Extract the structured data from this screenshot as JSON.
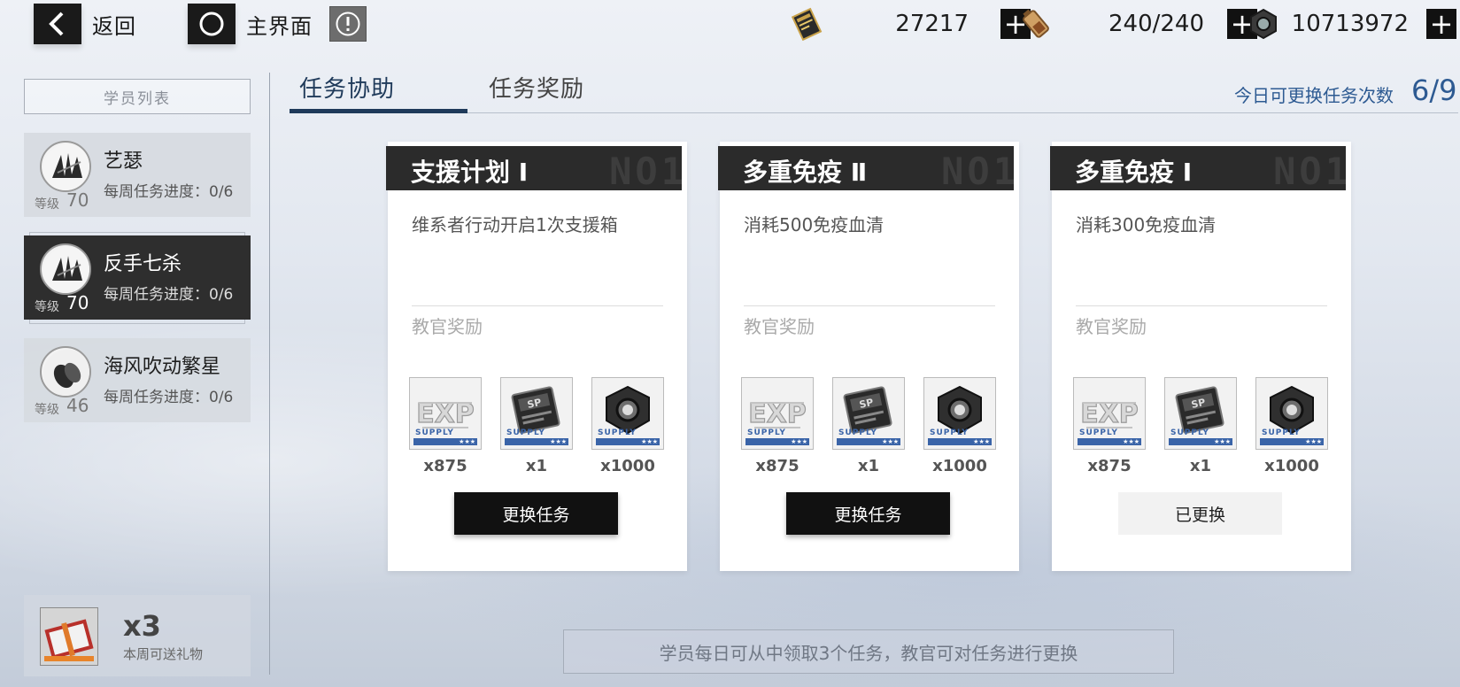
{
  "top_bar": {
    "back_label": "返回",
    "home_label": "主界面",
    "currencies": [
      {
        "icon": "ticket-icon",
        "value": "27217"
      },
      {
        "icon": "battery-icon",
        "value": "240/240"
      },
      {
        "icon": "hex-nut-icon",
        "value": "10713972"
      }
    ]
  },
  "sidebar": {
    "header": "学员列表",
    "level_label": "等级",
    "students": [
      {
        "name": "艺瑟",
        "progress": "每周任务进度：0/6",
        "level": "70",
        "active": false
      },
      {
        "name": "反手七杀",
        "progress": "每周任务进度：0/6",
        "level": "70",
        "active": true
      },
      {
        "name": "海风吹动繁星",
        "progress": "每周任务进度：0/6",
        "level": "46",
        "active": false
      }
    ],
    "gift": {
      "count": "x3",
      "label": "本周可送礼物"
    }
  },
  "tabs": [
    {
      "label": "任务协助",
      "active": true
    },
    {
      "label": "任务奖励",
      "active": false
    }
  ],
  "swap": {
    "label": "今日可更换任务次数",
    "value": "6/9"
  },
  "missions": [
    {
      "title": "支援计划 Ⅰ",
      "watermark": "NO1",
      "description": "维系者行动开启1次支援箱",
      "reward_label": "教官奖励",
      "rewards": [
        {
          "icon": "exp-chip-icon",
          "supply": "SUPPLY",
          "qty": "x875"
        },
        {
          "icon": "sp-card-icon",
          "supply": "SUPPLY",
          "qty": "x1"
        },
        {
          "icon": "hex-nut-icon",
          "supply": "SUPPLY",
          "qty": "x1000"
        }
      ],
      "button": "更换任务",
      "swapped": false
    },
    {
      "title": "多重免疫 Ⅱ",
      "watermark": "NO1",
      "description": "消耗500免疫血清",
      "reward_label": "教官奖励",
      "rewards": [
        {
          "icon": "exp-chip-icon",
          "supply": "SUPPLY",
          "qty": "x875"
        },
        {
          "icon": "sp-card-icon",
          "supply": "SUPPLY",
          "qty": "x1"
        },
        {
          "icon": "hex-nut-icon",
          "supply": "SUPPLY",
          "qty": "x1000"
        }
      ],
      "button": "更换任务",
      "swapped": false
    },
    {
      "title": "多重免疫 Ⅰ",
      "watermark": "NO1",
      "description": "消耗300免疫血清",
      "reward_label": "教官奖励",
      "rewards": [
        {
          "icon": "exp-chip-icon",
          "supply": "SUPPLY",
          "qty": "x875"
        },
        {
          "icon": "sp-card-icon",
          "supply": "SUPPLY",
          "qty": "x1"
        },
        {
          "icon": "hex-nut-icon",
          "supply": "SUPPLY",
          "qty": "x1000"
        }
      ],
      "button": "已更换",
      "swapped": true
    }
  ],
  "tip": "学员每日可从中领取3个任务，教官可对任务进行更换"
}
